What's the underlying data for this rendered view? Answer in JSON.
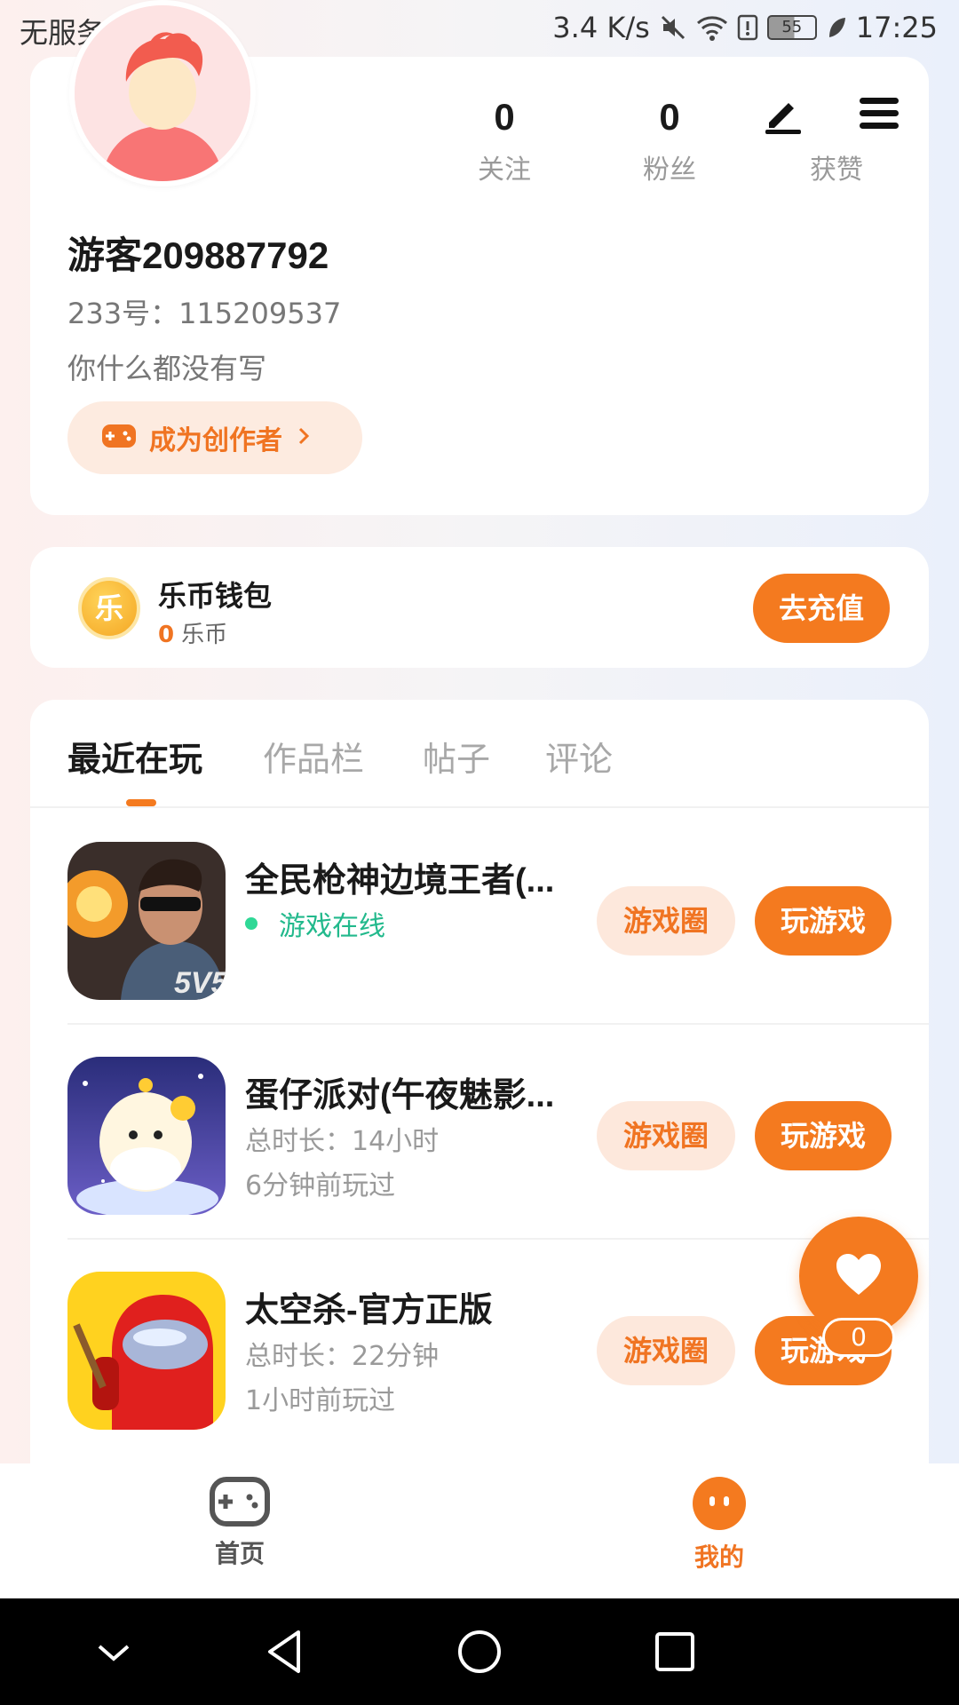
{
  "status_bar": {
    "carrier": "无服务",
    "speed": "3.4 K/s",
    "battery": "55",
    "time": "17:25"
  },
  "profile": {
    "stats": [
      {
        "value": "0",
        "label": "关注"
      },
      {
        "value": "0",
        "label": "粉丝"
      },
      {
        "value": "0",
        "label": "获赞"
      }
    ],
    "username": "游客209887792",
    "uid_text": "233号：115209537",
    "bio": "你什么都没有写",
    "creator_button": "成为创作者"
  },
  "wallet": {
    "coin_glyph": "乐",
    "title": "乐币钱包",
    "amount": "0",
    "unit": "乐币",
    "recharge": "去充值"
  },
  "tabs": [
    {
      "label": "最近在玩",
      "active": true
    },
    {
      "label": "作品栏",
      "active": false
    },
    {
      "label": "帖子",
      "active": false
    },
    {
      "label": "评论",
      "active": false
    }
  ],
  "games": [
    {
      "title": "全民枪神边境王者(...",
      "online": "游戏在线",
      "meta1": "",
      "meta2": "",
      "circle": "游戏圈",
      "play": "玩游戏"
    },
    {
      "title": "蛋仔派对(午夜魅影...",
      "online": "",
      "meta1": "总时长：14小时",
      "meta2": "6分钟前玩过",
      "circle": "游戏圈",
      "play": "玩游戏"
    },
    {
      "title": "太空杀-官方正版",
      "online": "",
      "meta1": "总时长：22分钟",
      "meta2": "1小时前玩过",
      "circle": "游戏圈",
      "play": "玩游戏"
    }
  ],
  "fab": {
    "count": "0",
    "icon": "heart-icon"
  },
  "bottom_nav": {
    "home": "首页",
    "mine": "我的"
  },
  "colors": {
    "accent": "#f47a1f",
    "accent_light": "#fde8dc",
    "online_green": "#22b98c"
  }
}
